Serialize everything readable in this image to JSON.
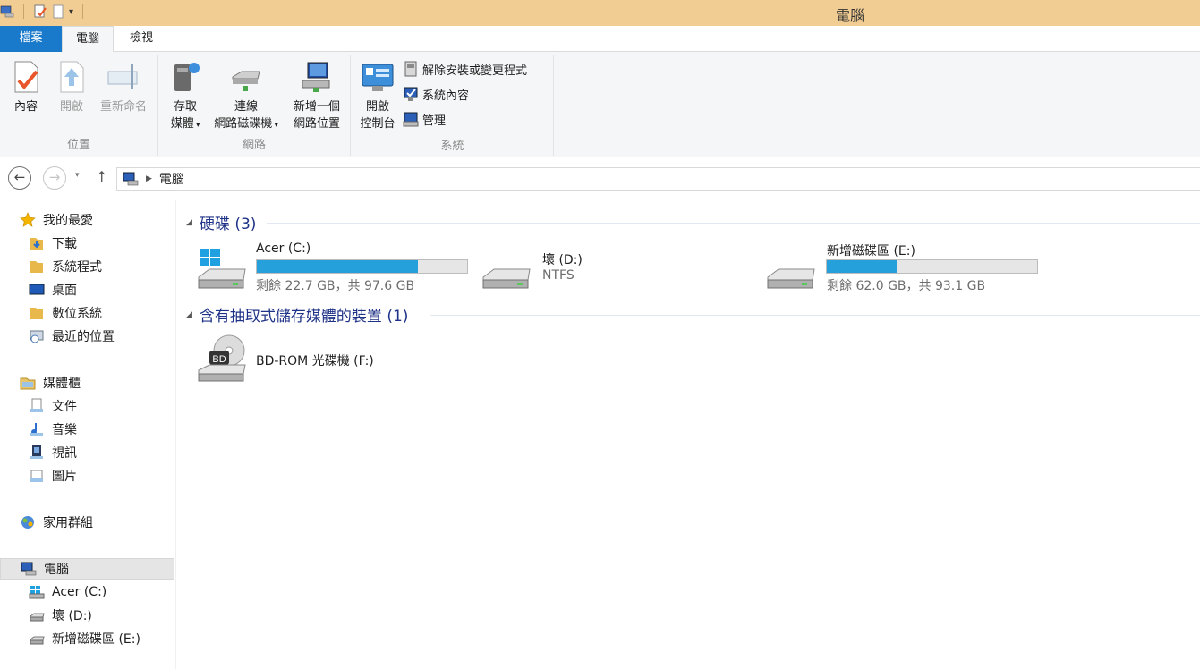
{
  "window": {
    "title": "電腦"
  },
  "ribbon": {
    "tabs": {
      "file": "檔案",
      "computer": "電腦",
      "view": "檢視"
    },
    "location_group": {
      "label": "位置",
      "properties": "內容",
      "open": "開啟",
      "rename": "重新命名"
    },
    "network_group": {
      "label": "網路",
      "access_media_line1": "存取",
      "access_media_line2": "媒體",
      "map_drive_line1": "連線",
      "map_drive_line2": "網路磁碟機",
      "add_location_line1": "新增一個",
      "add_location_line2": "網路位置"
    },
    "system_group": {
      "label": "系統",
      "control_panel_line1": "開啟",
      "control_panel_line2": "控制台",
      "uninstall": "解除安裝或變更程式",
      "system_properties": "系統內容",
      "manage": "管理"
    }
  },
  "address": {
    "path": "電腦"
  },
  "sidebar": {
    "favorites": {
      "label": "我的最愛",
      "items": [
        "下載",
        "系統程式",
        "桌面",
        "數位系統",
        "最近的位置"
      ]
    },
    "libraries": {
      "label": "媒體櫃",
      "items": [
        "文件",
        "音樂",
        "視訊",
        "圖片"
      ]
    },
    "homegroup": "家用群組",
    "computer": {
      "label": "電腦",
      "items": [
        "Acer (C:)",
        "壞 (D:)",
        "新增磁碟區 (E:)"
      ]
    }
  },
  "content": {
    "hard_drives_header": "硬碟 (3)",
    "removable_header": "含有抽取式儲存媒體的裝置 (1)",
    "drives": [
      {
        "name": "Acer (C:)",
        "info": "剩餘 22.7 GB，共 97.6 GB",
        "used_fraction": 0.767
      },
      {
        "name": "壞 (D:)",
        "info": "NTFS"
      },
      {
        "name": "新增磁碟區 (E:)",
        "info": "剩餘 62.0 GB，共 93.1 GB",
        "used_fraction": 0.334
      }
    ],
    "optical": {
      "name": "BD-ROM 光碟機 (F:)",
      "badge": "BD"
    }
  },
  "colors": {
    "titlebar": "#f2cd93",
    "file_tab": "#1979ca",
    "progress": "#26a0da",
    "section_header": "#1e3287"
  }
}
